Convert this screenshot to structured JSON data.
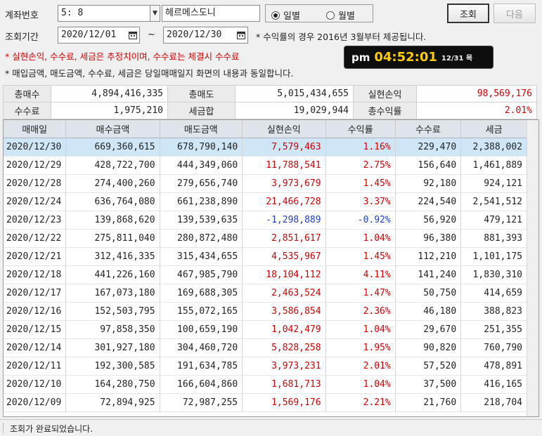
{
  "query": {
    "account_label": "계좌번호",
    "account_value": "5:        8",
    "account_name": "헤르메스도니",
    "radio_options": [
      {
        "label": "일별",
        "selected": true
      },
      {
        "label": "월별",
        "selected": false
      }
    ],
    "period_label": "조회기간",
    "start_date": "2020/12/01",
    "end_date": "2020/12/30",
    "tilde": "~",
    "search_button": "조회",
    "next_button": "다음"
  },
  "notices": {
    "line1": "* 수익률의 경우 2016년 3월부터 제공됩니다.",
    "line2": "* 실현손익, 수수료, 세금은 추정치이며, 수수료는 체결시 수수료",
    "line3": "* 매입금액, 매도금액, 수수료, 세금은 당일매매일지 화면의 내용과 동일합니다."
  },
  "clock": {
    "ampm": "pm",
    "time": "04:52:01",
    "date": "12/31 목"
  },
  "summary": {
    "total_buy_label": "총매수",
    "total_buy": "4,894,416,335",
    "total_sell_label": "총매도",
    "total_sell": "5,015,434,655",
    "realized_label": "실현손익",
    "realized": "98,569,176",
    "fee_label": "수수료",
    "fee": "1,975,210",
    "tax_label": "세금합",
    "tax": "19,029,944",
    "total_return_label": "총수익률",
    "total_return": "2.01%"
  },
  "columns": [
    "매매일",
    "매수금액",
    "매도금액",
    "실현손익",
    "수익률",
    "수수료",
    "세금"
  ],
  "rows": [
    {
      "date": "2020/12/30",
      "buy": "669,360,615",
      "sell": "678,790,140",
      "pnl": "7,579,463",
      "rate": "1.16%",
      "fee": "229,470",
      "tax": "2,388,002",
      "sign": "pos",
      "selected": true
    },
    {
      "date": "2020/12/29",
      "buy": "428,722,700",
      "sell": "444,349,060",
      "pnl": "11,788,541",
      "rate": "2.75%",
      "fee": "156,640",
      "tax": "1,461,889",
      "sign": "pos"
    },
    {
      "date": "2020/12/28",
      "buy": "274,400,260",
      "sell": "279,656,740",
      "pnl": "3,973,679",
      "rate": "1.45%",
      "fee": "92,180",
      "tax": "924,121",
      "sign": "pos"
    },
    {
      "date": "2020/12/24",
      "buy": "636,764,080",
      "sell": "661,238,890",
      "pnl": "21,466,728",
      "rate": "3.37%",
      "fee": "224,540",
      "tax": "2,541,512",
      "sign": "pos"
    },
    {
      "date": "2020/12/23",
      "buy": "139,868,620",
      "sell": "139,539,635",
      "pnl": "-1,298,889",
      "rate": "-0.92%",
      "fee": "56,920",
      "tax": "479,121",
      "sign": "neg"
    },
    {
      "date": "2020/12/22",
      "buy": "275,811,040",
      "sell": "280,872,480",
      "pnl": "2,851,617",
      "rate": "1.04%",
      "fee": "96,380",
      "tax": "881,393",
      "sign": "pos"
    },
    {
      "date": "2020/12/21",
      "buy": "312,416,335",
      "sell": "315,434,655",
      "pnl": "4,535,967",
      "rate": "1.45%",
      "fee": "112,210",
      "tax": "1,101,175",
      "sign": "pos"
    },
    {
      "date": "2020/12/18",
      "buy": "441,226,160",
      "sell": "467,985,790",
      "pnl": "18,104,112",
      "rate": "4.11%",
      "fee": "141,240",
      "tax": "1,830,310",
      "sign": "pos"
    },
    {
      "date": "2020/12/17",
      "buy": "167,073,180",
      "sell": "169,688,305",
      "pnl": "2,463,524",
      "rate": "1.47%",
      "fee": "50,750",
      "tax": "414,659",
      "sign": "pos"
    },
    {
      "date": "2020/12/16",
      "buy": "152,503,795",
      "sell": "155,072,165",
      "pnl": "3,586,854",
      "rate": "2.36%",
      "fee": "46,180",
      "tax": "388,823",
      "sign": "pos"
    },
    {
      "date": "2020/12/15",
      "buy": "97,858,350",
      "sell": "100,659,190",
      "pnl": "1,042,479",
      "rate": "1.04%",
      "fee": "29,670",
      "tax": "251,355",
      "sign": "pos"
    },
    {
      "date": "2020/12/14",
      "buy": "301,927,180",
      "sell": "304,460,720",
      "pnl": "5,828,258",
      "rate": "1.95%",
      "fee": "90,820",
      "tax": "760,790",
      "sign": "pos"
    },
    {
      "date": "2020/12/11",
      "buy": "192,300,585",
      "sell": "191,634,785",
      "pnl": "3,973,231",
      "rate": "2.01%",
      "fee": "57,520",
      "tax": "478,891",
      "sign": "pos"
    },
    {
      "date": "2020/12/10",
      "buy": "164,280,750",
      "sell": "166,604,860",
      "pnl": "1,681,713",
      "rate": "1.04%",
      "fee": "37,500",
      "tax": "416,165",
      "sign": "pos"
    },
    {
      "date": "2020/12/09",
      "buy": "72,894,925",
      "sell": "72,987,255",
      "pnl": "1,569,176",
      "rate": "2.21%",
      "fee": "21,760",
      "tax": "218,704",
      "sign": "pos"
    }
  ],
  "status": {
    "message": "조회가 완료되었습니다."
  },
  "colors": {
    "positive": "#d00000",
    "negative": "#1a3fd0",
    "selected_row": "#cfe6f7",
    "header_bg": "#dfe3ea"
  }
}
